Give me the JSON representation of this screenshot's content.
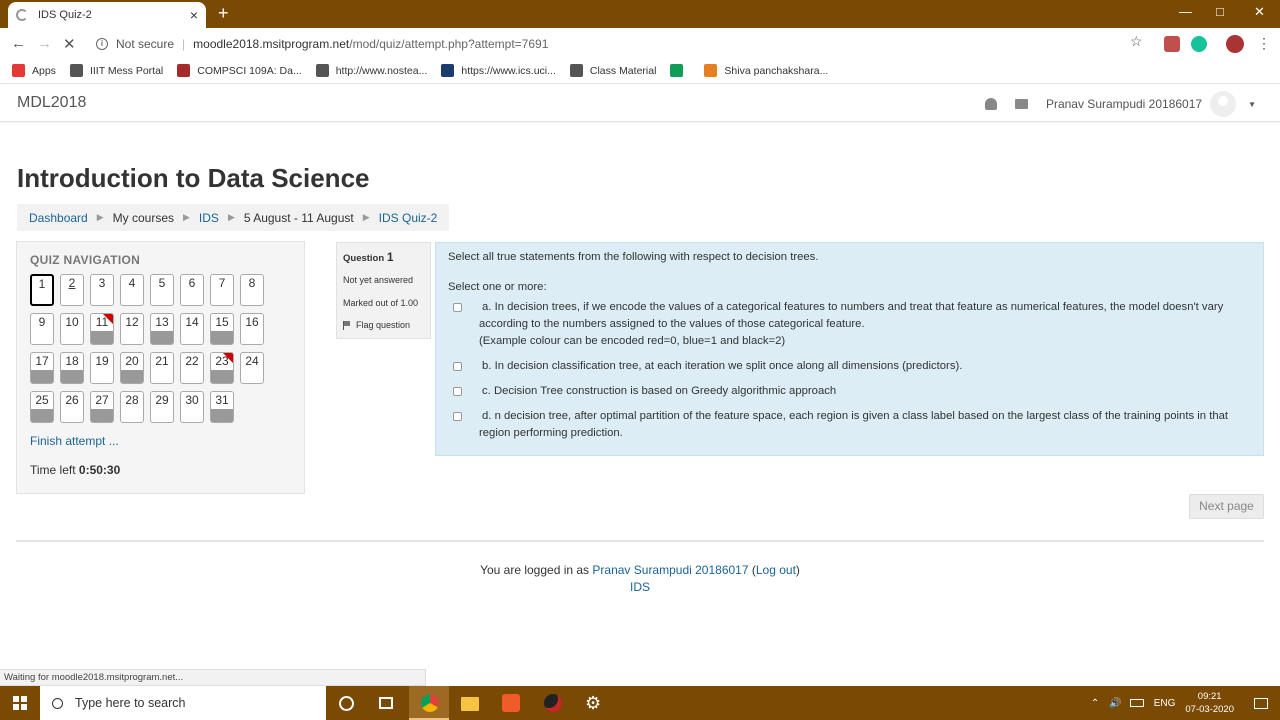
{
  "browser": {
    "tab_title": "IDS Quiz-2",
    "tab_close": "×",
    "new_tab": "+",
    "security_label": "Not secure",
    "url_host": "moodle2018.msitprogram.net",
    "url_path": "/mod/quiz/attempt.php?attempt=7691",
    "status_text": "Waiting for moodle2018.msitprogram.net..."
  },
  "bookmarks": [
    {
      "label": "Apps",
      "color": "#e53935"
    },
    {
      "label": "IIIT Mess Portal",
      "color": "#555555"
    },
    {
      "label": "COMPSCI 109A: Da...",
      "color": "#a52a2a"
    },
    {
      "label": "http://www.nostea...",
      "color": "#555555"
    },
    {
      "label": "https://www.ics.uci...",
      "color": "#1a3c6e"
    },
    {
      "label": "Class Material",
      "color": "#555555"
    },
    {
      "label": "",
      "color": "#0f9d58"
    },
    {
      "label": "Shiva panchakshara...",
      "color": "#e67e22"
    }
  ],
  "navbar": {
    "brand": "MDL2018",
    "user_name": "Pranav Surampudi 20186017"
  },
  "page": {
    "title": "Introduction to Data Science",
    "breadcrumb": [
      "Dashboard",
      "My courses",
      "IDS",
      "5 August - 11 August",
      "IDS Quiz-2"
    ]
  },
  "quiz_nav": {
    "heading": "QUIZ NAVIGATION",
    "questions": [
      {
        "n": "1",
        "state": "current"
      },
      {
        "n": "2",
        "state": "hover"
      },
      {
        "n": "3",
        "state": "notyet"
      },
      {
        "n": "4",
        "state": "notyet"
      },
      {
        "n": "5",
        "state": "notyet"
      },
      {
        "n": "6",
        "state": "notyet"
      },
      {
        "n": "7",
        "state": "notyet"
      },
      {
        "n": "8",
        "state": "notyet"
      },
      {
        "n": "9",
        "state": "notyet"
      },
      {
        "n": "10",
        "state": "notyet"
      },
      {
        "n": "11",
        "state": "answered-flagged"
      },
      {
        "n": "12",
        "state": "notyet"
      },
      {
        "n": "13",
        "state": "answered"
      },
      {
        "n": "14",
        "state": "notyet"
      },
      {
        "n": "15",
        "state": "answered"
      },
      {
        "n": "16",
        "state": "notyet"
      },
      {
        "n": "17",
        "state": "answered"
      },
      {
        "n": "18",
        "state": "answered"
      },
      {
        "n": "19",
        "state": "notyet"
      },
      {
        "n": "20",
        "state": "answered"
      },
      {
        "n": "21",
        "state": "notyet"
      },
      {
        "n": "22",
        "state": "notyet"
      },
      {
        "n": "23",
        "state": "answered-flagged"
      },
      {
        "n": "24",
        "state": "notyet"
      },
      {
        "n": "25",
        "state": "answered"
      },
      {
        "n": "26",
        "state": "notyet"
      },
      {
        "n": "27",
        "state": "answered"
      },
      {
        "n": "28",
        "state": "notyet"
      },
      {
        "n": "29",
        "state": "notyet"
      },
      {
        "n": "30",
        "state": "notyet"
      },
      {
        "n": "31",
        "state": "answered"
      }
    ],
    "finish_label": "Finish attempt ...",
    "time_left_label": "Time left",
    "time_left_value": "0:50:30"
  },
  "question": {
    "label": "Question",
    "number": "1",
    "state": "Not yet answered",
    "marks": "Marked out of 1.00",
    "flag_label": "Flag question",
    "text": "Select all true statements from the following with respect to decision trees.",
    "prompt": "Select one or more:",
    "options": [
      {
        "letter": "a.",
        "text": "In decision trees, if we encode the values of a categorical features to numbers and treat that feature as  numerical features, the model doesn't vary  according to the numbers assigned to the values of those categorical feature.\n(Example colour can be encoded red=0, blue=1 and black=2)"
      },
      {
        "letter": "b.",
        "text": "In decision classification tree, at each iteration we split once along all dimensions (predictors)."
      },
      {
        "letter": "c.",
        "text": "Decision Tree construction is based on Greedy algorithmic approach"
      },
      {
        "letter": "d.",
        "text": "n decision tree, after optimal partition of the feature space, each region is given a class label based on the largest class of the training points in that region performing prediction."
      }
    ],
    "next_label": "Next page"
  },
  "footer": {
    "prefix": "You are logged in as",
    "user": "Pranav Surampudi 20186017",
    "logout": "Log out",
    "course": "IDS"
  },
  "taskbar": {
    "search_placeholder": "Type here to search",
    "lang": "ENG",
    "time": "09:21",
    "date": "07-03-2020"
  },
  "colors": {
    "chrome_frame": "#7a4a05",
    "link": "#1a6496",
    "question_bg": "#dcedf5",
    "flag": "#cc0000"
  }
}
